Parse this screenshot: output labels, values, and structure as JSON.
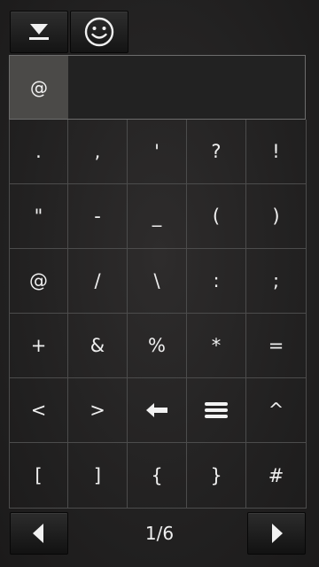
{
  "toolbar": {
    "hide_icon": "hide-keyboard-icon",
    "smiley_icon": "smiley-icon"
  },
  "input": {
    "selected_char": "@"
  },
  "grid": {
    "rows": [
      [
        ".",
        ",",
        "'",
        "?",
        "!"
      ],
      [
        "\"",
        "-",
        "_",
        "(",
        ")"
      ],
      [
        "@",
        "/",
        "\\",
        ":",
        ";"
      ],
      [
        "+",
        "&",
        "%",
        "*",
        "="
      ],
      [
        "<",
        ">",
        "backspace-icon",
        "enter-icon",
        "^"
      ],
      [
        "[",
        "]",
        "{",
        "}",
        "#"
      ]
    ]
  },
  "pager": {
    "current_page": "1/6",
    "prev_icon": "left-arrow-icon",
    "next_icon": "right-arrow-icon"
  },
  "colors": {
    "background": "#242323",
    "grid_line": "#4c4c4c",
    "selected_cell": "#4b4a48",
    "text": "#efefef"
  }
}
